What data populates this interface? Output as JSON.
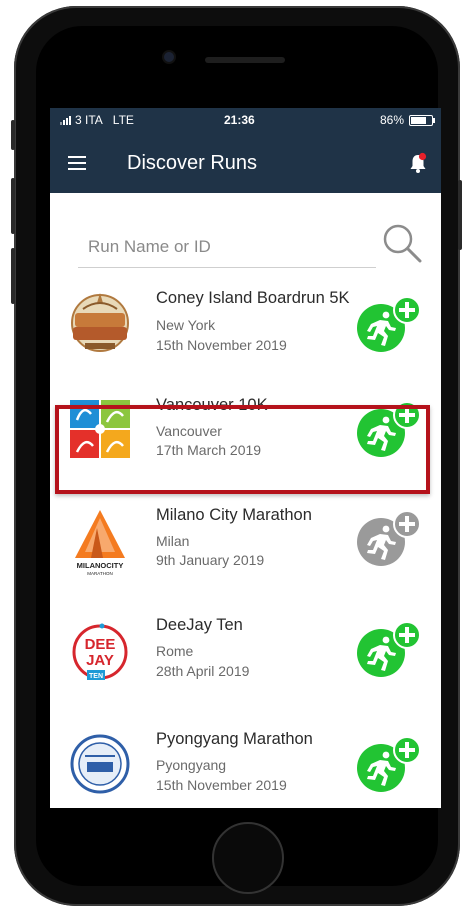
{
  "status_bar": {
    "carrier": "3 ITA",
    "network": "LTE",
    "time": "21:36",
    "battery_text": "86%",
    "battery_level": 0.86
  },
  "header": {
    "title": "Discover Runs",
    "menu_icon": "hamburger-menu-icon",
    "notification_icon": "bell-icon",
    "notification_dot_color": "#e8202a",
    "background_color": "#1f3347"
  },
  "search": {
    "placeholder": "Run Name or ID",
    "value": "",
    "icon": "search-icon"
  },
  "runs": [
    {
      "name": "Coney Island Boardrun 5K",
      "city": "New York",
      "date": "15th November 2019",
      "logo": "coney-island-brewing-logo",
      "enabled": true
    },
    {
      "name": "Vancouver 10K",
      "city": "Vancouver",
      "date": "17th March 2019",
      "logo": "vancouver-10k-logo",
      "enabled": true,
      "highlighted": true
    },
    {
      "name": "Milano City Marathon",
      "city": "Milan",
      "date": "9th January  2019",
      "logo": "milano-city-marathon-logo",
      "logo_text": "MILANOCITY",
      "logo_subtext": "MARATHON",
      "enabled": false
    },
    {
      "name": "DeeJay Ten",
      "city": "Rome",
      "date": "28th April 2019",
      "logo": "deejay-ten-logo",
      "logo_text": "DEE JAY",
      "logo_subtext": "TEN",
      "enabled": true
    },
    {
      "name": "Pyongyang Marathon",
      "city": "Pyongyang",
      "date": "15th November 2019",
      "logo": "pyongyang-marathon-logo",
      "enabled": true
    }
  ],
  "colors": {
    "add_active": "#22c433",
    "add_disabled": "#9a9a9a",
    "highlight_border": "#b5121b"
  }
}
